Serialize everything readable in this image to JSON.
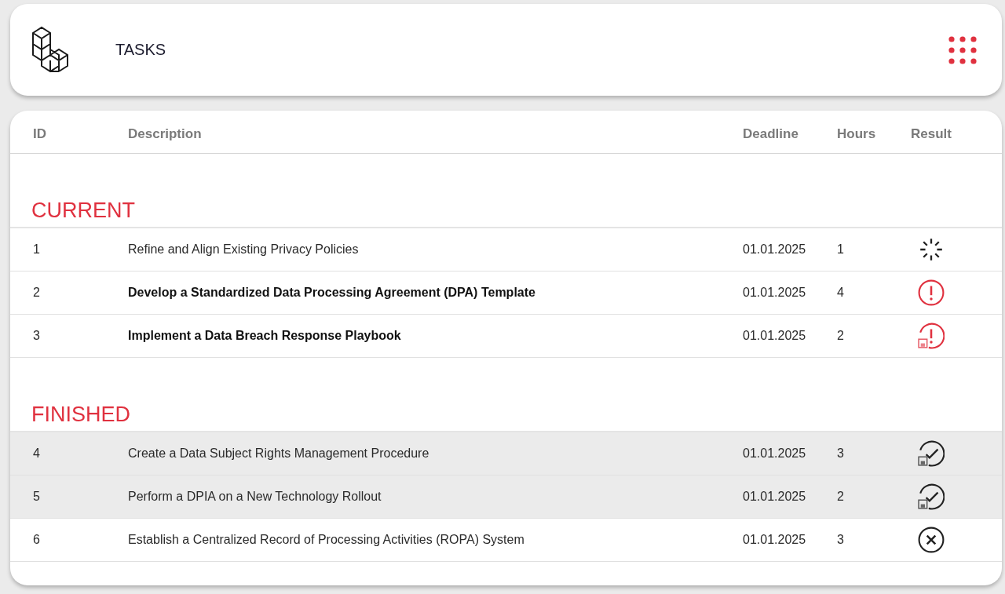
{
  "header": {
    "title": "TASKS"
  },
  "table": {
    "columns": [
      "ID",
      "Description",
      "Deadline",
      "Hours",
      "Result"
    ],
    "sections": [
      {
        "title": "CURRENT",
        "rows": [
          {
            "id": "1",
            "description": "Refine and Align Existing Privacy Policies",
            "deadline": "01.01.2025",
            "hours": "1",
            "unread": false,
            "selected": false,
            "kind": "loading"
          },
          {
            "id": "2",
            "description": "Develop a Standardized Data Processing Agreement (DPA) Template",
            "deadline": "01.01.2025",
            "hours": "4",
            "unread": true,
            "selected": false,
            "kind": "alert"
          },
          {
            "id": "3",
            "description": "Implement a Data Breach Response Playbook",
            "deadline": "01.01.2025",
            "hours": "2",
            "unread": true,
            "selected": false,
            "kind": "alert_saved"
          }
        ]
      },
      {
        "title": "FINISHED",
        "rows": [
          {
            "id": "4",
            "description": "Create a Data Subject Rights Management Procedure",
            "deadline": "01.01.2025",
            "hours": "3",
            "unread": false,
            "selected": true,
            "kind": "done_saved"
          },
          {
            "id": "5",
            "description": "Perform a DPIA on a New Technology Rollout",
            "deadline": "01.01.2025",
            "hours": "2",
            "unread": false,
            "selected": true,
            "kind": "done_saved"
          },
          {
            "id": "6",
            "description": "Establish a Centralized Record of Processing Activities (ROPA) System",
            "deadline": "01.01.2025",
            "hours": "3",
            "unread": false,
            "selected": false,
            "kind": "failed"
          }
        ]
      }
    ]
  }
}
